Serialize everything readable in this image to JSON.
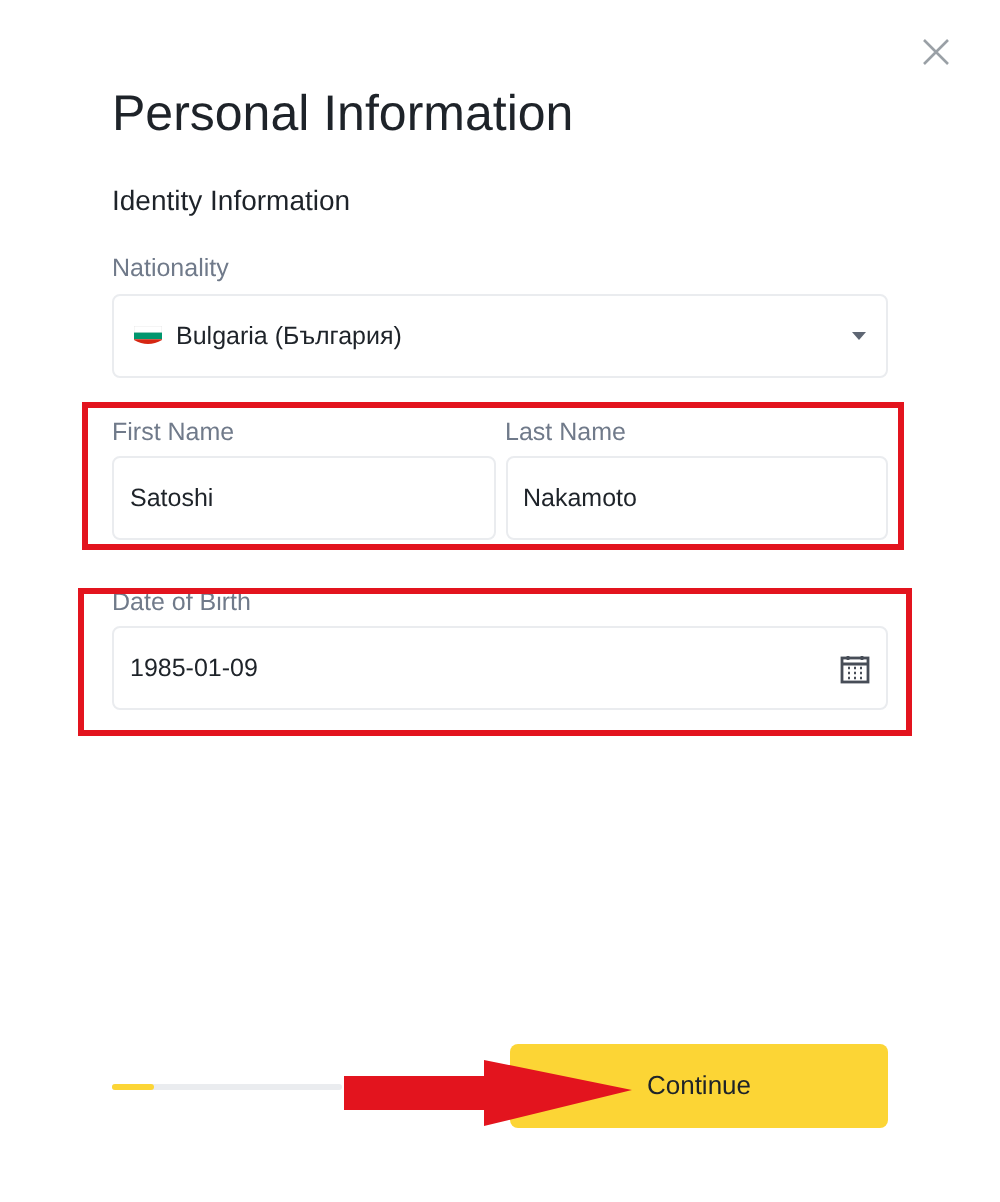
{
  "title": "Personal Information",
  "section": "Identity Information",
  "nationality": {
    "label": "Nationality",
    "value": "Bulgaria (България)"
  },
  "name_fields": [
    {
      "label": "First Name",
      "value": "Satoshi"
    },
    {
      "label": "Last Name",
      "value": "Nakamoto"
    }
  ],
  "date_of_birth": {
    "label": "Date of Birth",
    "value": "1985-01-09"
  },
  "progress": {
    "level": 0.18
  },
  "continue_button": "Continue"
}
